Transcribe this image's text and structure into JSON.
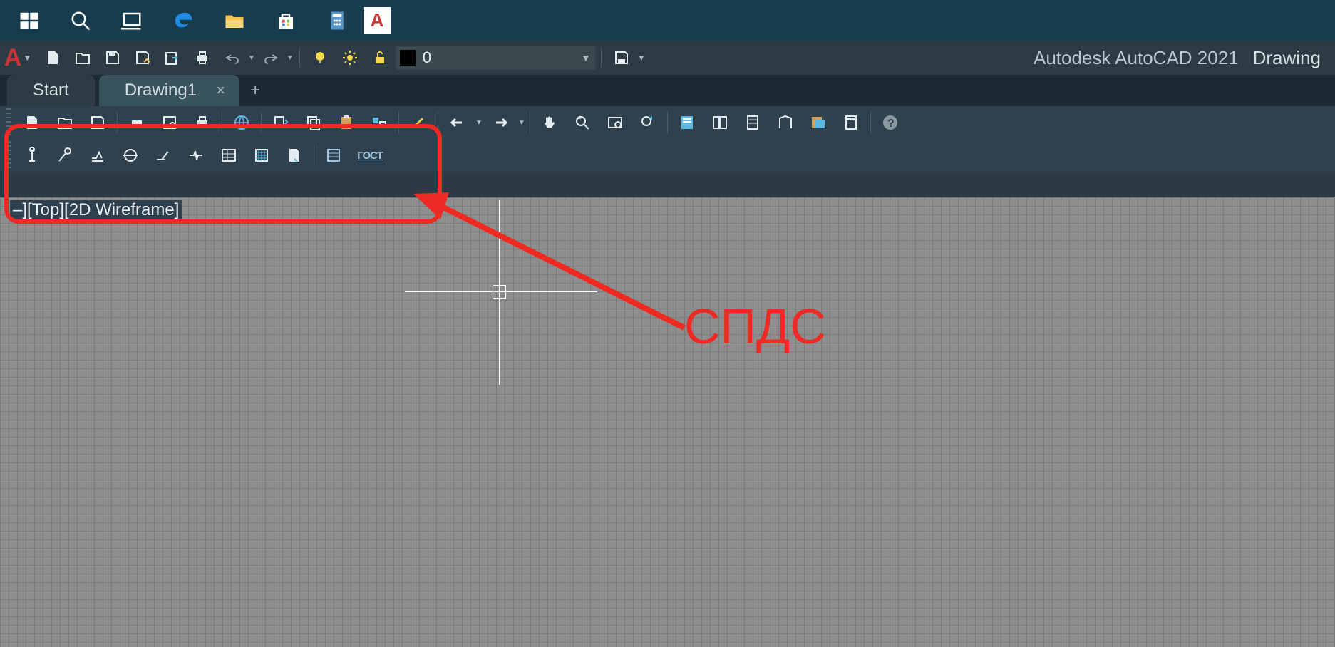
{
  "taskbar": {
    "items": [
      "windows",
      "search",
      "task-view",
      "edge",
      "explorer",
      "store",
      "calculator",
      "autocad"
    ]
  },
  "title": {
    "app_name": "Autodesk AutoCAD 2021",
    "file_name": "Drawing"
  },
  "layer": {
    "name": "0"
  },
  "tabs": {
    "start": "Start",
    "active": "Drawing1"
  },
  "viewport": {
    "label": "–][Top][2D Wireframe]"
  },
  "spds_toolbar": {
    "gost_label": "ГОСТ"
  },
  "annotation": {
    "label": "СПДС"
  }
}
